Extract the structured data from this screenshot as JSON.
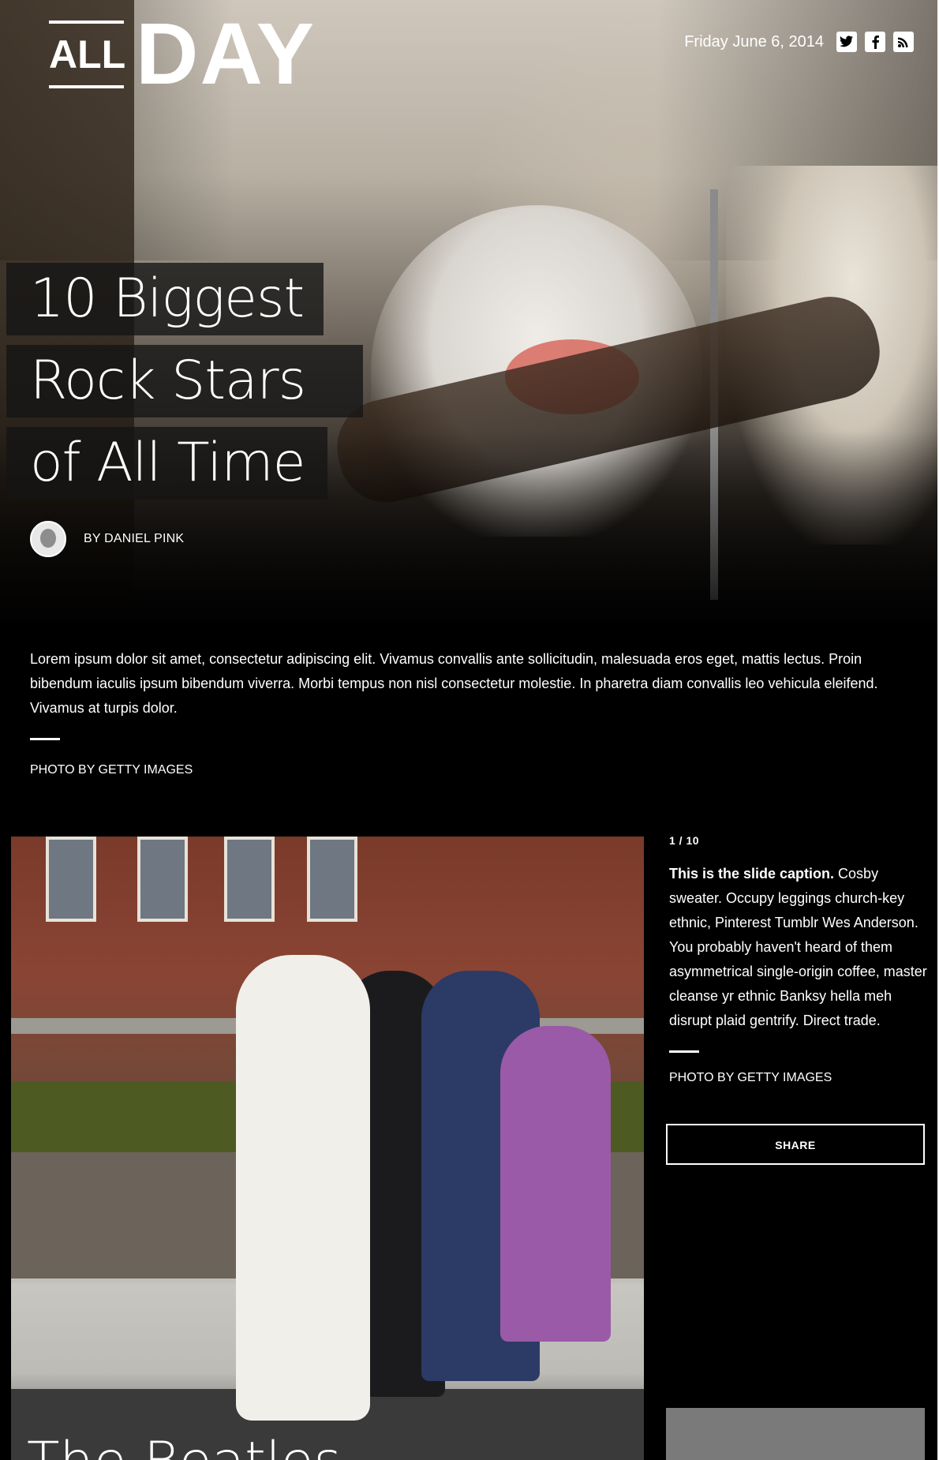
{
  "brand": {
    "logo_all": "ALL",
    "logo_day": "DAY"
  },
  "header": {
    "date": "Friday June 6, 2014",
    "social": [
      {
        "name": "twitter-icon",
        "glyph": "🐦"
      },
      {
        "name": "facebook-icon",
        "glyph": "f"
      },
      {
        "name": "rss-icon",
        "glyph": "◉"
      }
    ]
  },
  "article": {
    "headline_lines": [
      "10 Biggest",
      "Rock Stars",
      "of All Time"
    ],
    "byline": "BY DANIEL PINK",
    "intro": "Lorem ipsum dolor sit amet, consectetur adipiscing elit. Vivamus convallis ante sollicitudin, malesuada eros eget, mattis lectus. Proin bibendum iaculis ipsum bibendum viverra. Morbi tempus non nisl consectetur molestie. In pharetra diam convallis leo vehicula eleifend. Vivamus at turpis dolor.",
    "photo_credit": "PHOTO BY GETTY IMAGES"
  },
  "slide": {
    "counter": "1 / 10",
    "caption_bold": "This is the slide caption.",
    "caption_text": " Cosby sweater. Occupy leggings church-key ethnic, Pinterest Tumblr Wes Anderson. You probably haven't heard of them asymmetrical single-origin coffee, master cleanse yr ethnic Banksy hella meh disrupt plaid gentrify. Direct trade.",
    "photo_credit": "PHOTO BY GETTY IMAGES",
    "share_label": "SHARE",
    "title_partial": "The Beatles"
  }
}
